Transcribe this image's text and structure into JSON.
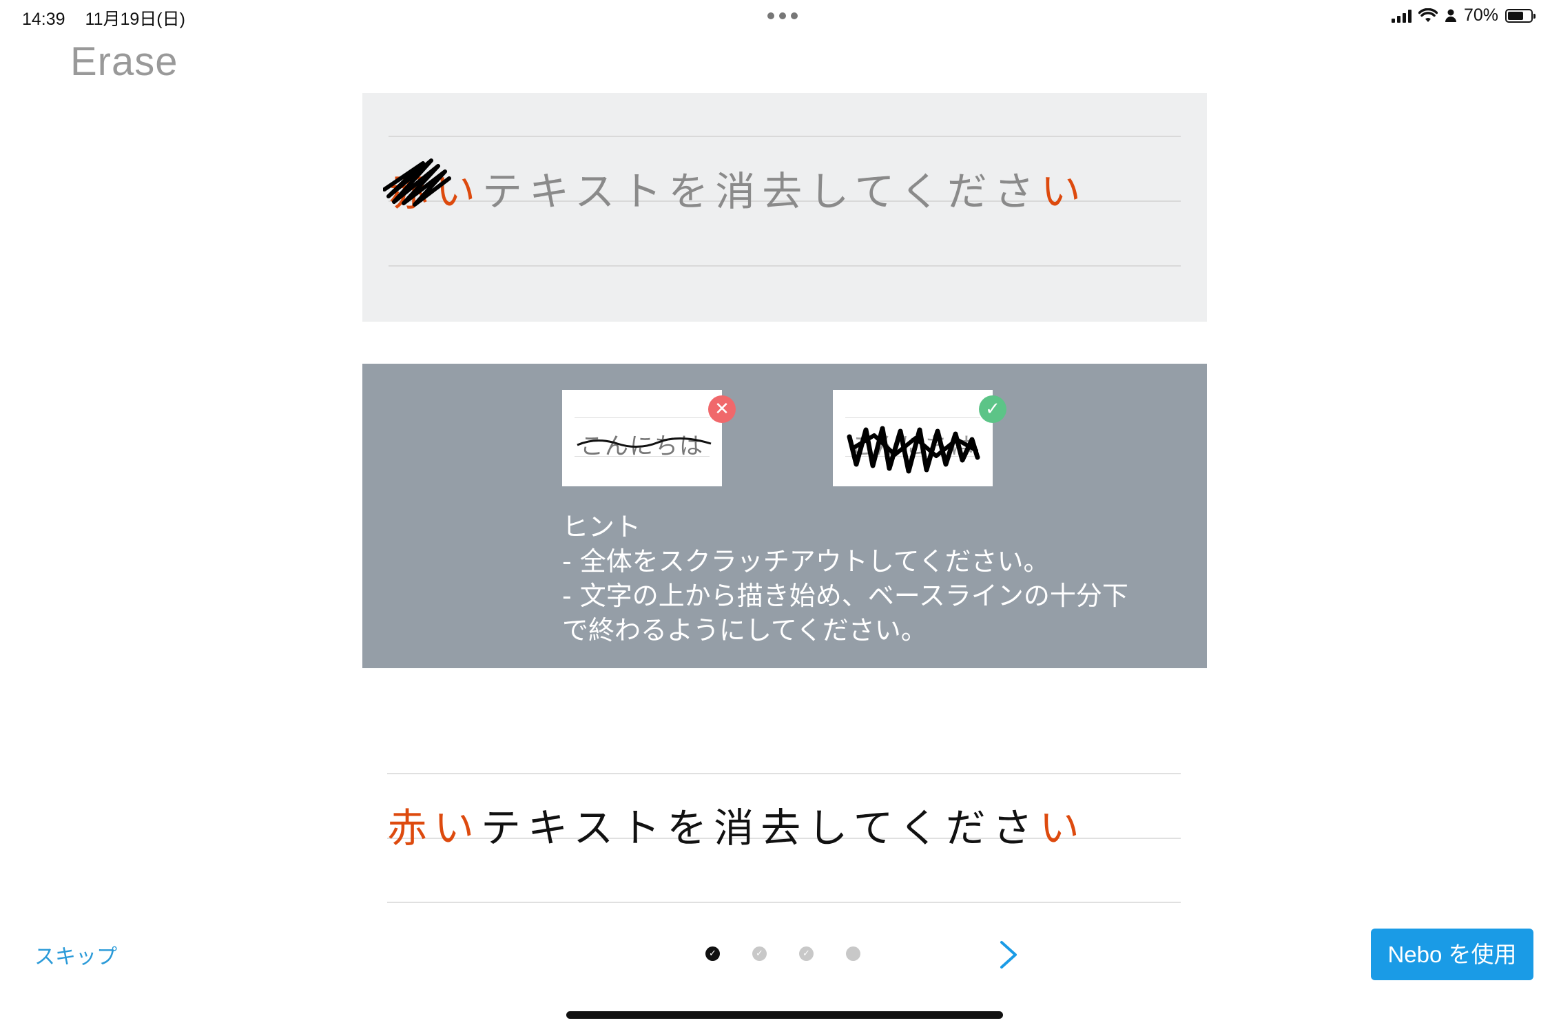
{
  "status_bar": {
    "time": "14:39",
    "date": "11月19日(日)",
    "battery": "70%",
    "battery_level": 0.7
  },
  "page_title": "Erase",
  "example": {
    "prefix_red": "赤い",
    "middle_text": "テキストを消去してくださ",
    "suffix_red": "い"
  },
  "hint": {
    "bad_sample_text": "こんにちは",
    "good_sample_text": "こんにちは",
    "bad_badge": "✕",
    "good_badge": "✓",
    "text": "ヒント\n- 全体をスクラッチアウトしてください。\n- 文字の上から描き始め、ベースラインの十分下\nで終わるようにしてください。"
  },
  "practice": {
    "prefix_red": "赤い",
    "middle_text": "テキストを消去してくださ",
    "suffix_red": "い"
  },
  "navigation": {
    "skip_label": "スキップ",
    "use_button_label": "Nebo を使用",
    "pager": [
      "✓",
      "✓",
      "✓",
      ""
    ]
  },
  "colors": {
    "accent_blue": "#1a9be6",
    "link_blue": "#2a9ad8",
    "red_text": "#dd4a0e",
    "hint_panel": "#959ea7",
    "bad_badge": "#f0686b",
    "good_badge": "#5cc487"
  }
}
